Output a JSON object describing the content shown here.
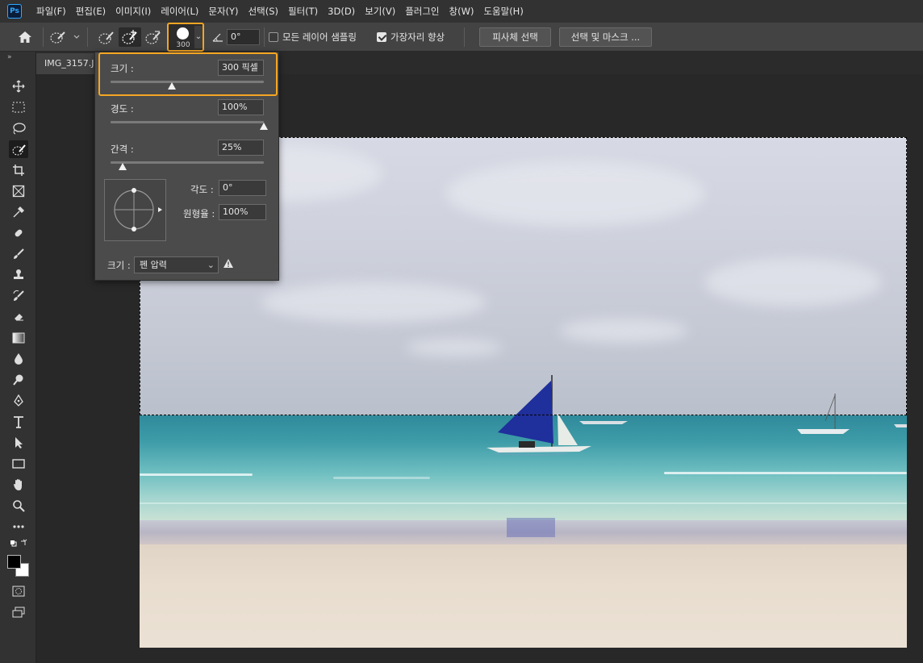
{
  "app": {
    "logo_text": "Ps"
  },
  "menu": [
    "파일(F)",
    "편집(E)",
    "이미지(I)",
    "레이어(L)",
    "문자(Y)",
    "선택(S)",
    "필터(T)",
    "3D(D)",
    "보기(V)",
    "플러그인",
    "창(W)",
    "도움말(H)"
  ],
  "options_bar": {
    "home_icon": "home-icon",
    "brush_size_value": "300",
    "angle_value": "0°",
    "sample_all_layers_label": "모든 레이어 샘플링",
    "sample_all_layers_checked": false,
    "enhance_edge_label": "가장자리 향상",
    "enhance_edge_checked": true,
    "select_subject_label": "피사체 선택",
    "select_and_mask_label": "선택 및 마스크 ...",
    "accent_color": "#f5a623"
  },
  "document": {
    "tab_title": "IMG_3157.JPG"
  },
  "brush_popup": {
    "size_label": "크기 :",
    "size_value": "300 픽셀",
    "size_level": 0.4,
    "hardness_label": "경도 :",
    "hardness_value": "100%",
    "hardness_level": 1.0,
    "spacing_label": "간격 :",
    "spacing_value": "25%",
    "spacing_level": 0.08,
    "angle_label": "각도 :",
    "angle_value": "0°",
    "roundness_label": "원형율 :",
    "roundness_value": "100%",
    "pressure_label": "크기 :",
    "pressure_select": "펜 압력",
    "warning_icon": "warning-icon"
  }
}
